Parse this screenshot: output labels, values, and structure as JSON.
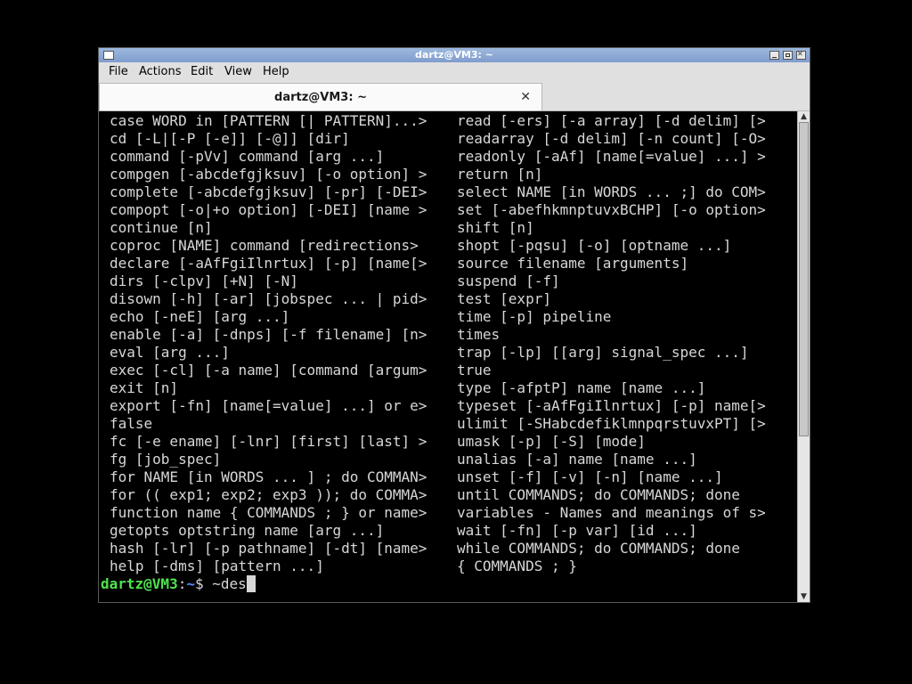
{
  "window": {
    "title": "dartz@VM3: ~"
  },
  "menu": [
    "File",
    "Actions",
    "Edit",
    "View",
    "Help"
  ],
  "tab": {
    "title": "dartz@VM3: ~",
    "close_icon": "✕"
  },
  "terminal": {
    "rows": [
      {
        "left": "case WORD in [PATTERN [| PATTERN]...>",
        "right": "read [-ers] [-a array] [-d delim] [>"
      },
      {
        "left": "cd [-L|[-P [-e]] [-@]] [dir]",
        "right": "readarray [-d delim] [-n count] [-O>"
      },
      {
        "left": "command [-pVv] command [arg ...]",
        "right": "readonly [-aAf] [name[=value] ...] >"
      },
      {
        "left": "compgen [-abcdefgjksuv] [-o option] >",
        "right": "return [n]"
      },
      {
        "left": "complete [-abcdefgjksuv] [-pr] [-DEI>",
        "right": "select NAME [in WORDS ... ;] do COM>"
      },
      {
        "left": "compopt [-o|+o option] [-DEI] [name >",
        "right": "set [-abefhkmnptuvxBCHP] [-o option>"
      },
      {
        "left": "continue [n]",
        "right": "shift [n]"
      },
      {
        "left": "coproc [NAME] command [redirections>",
        "right": "shopt [-pqsu] [-o] [optname ...]"
      },
      {
        "left": "declare [-aAfFgiIlnrtux] [-p] [name[>",
        "right": "source filename [arguments]"
      },
      {
        "left": "dirs [-clpv] [+N] [-N]",
        "right": "suspend [-f]"
      },
      {
        "left": "disown [-h] [-ar] [jobspec ... | pid>",
        "right": "test [expr]"
      },
      {
        "left": "echo [-neE] [arg ...]",
        "right": "time [-p] pipeline"
      },
      {
        "left": "enable [-a] [-dnps] [-f filename] [n>",
        "right": "times"
      },
      {
        "left": "eval [arg ...]",
        "right": "trap [-lp] [[arg] signal_spec ...]"
      },
      {
        "left": "exec [-cl] [-a name] [command [argum>",
        "right": "true"
      },
      {
        "left": "exit [n]",
        "right": "type [-afptP] name [name ...]"
      },
      {
        "left": "export [-fn] [name[=value] ...] or e>",
        "right": "typeset [-aAfFgiIlnrtux] [-p] name[>"
      },
      {
        "left": "false",
        "right": "ulimit [-SHabcdefiklmnpqrstuvxPT] [>"
      },
      {
        "left": "fc [-e ename] [-lnr] [first] [last] >",
        "right": "umask [-p] [-S] [mode]"
      },
      {
        "left": "fg [job_spec]",
        "right": "unalias [-a] name [name ...]"
      },
      {
        "left": "for NAME [in WORDS ... ] ; do COMMAN>",
        "right": "unset [-f] [-v] [-n] [name ...]"
      },
      {
        "left": "for (( exp1; exp2; exp3 )); do COMMA>",
        "right": "until COMMANDS; do COMMANDS; done"
      },
      {
        "left": "function name { COMMANDS ; } or name>",
        "right": "variables - Names and meanings of s>"
      },
      {
        "left": "getopts optstring name [arg ...]",
        "right": "wait [-fn] [-p var] [id ...]"
      },
      {
        "left": "hash [-lr] [-p pathname] [-dt] [name>",
        "right": "while COMMANDS; do COMMANDS; done"
      },
      {
        "left": "help [-dms] [pattern ...]",
        "right": "{ COMMANDS ; }"
      }
    ],
    "prompt": {
      "user_host": "dartz@VM3",
      "separator": ":",
      "path": "~",
      "symbol": "$ ",
      "input": "~des"
    }
  },
  "scrollbar": {
    "up_icon": "▲",
    "down_icon": "▼",
    "position": 0.0,
    "visible_fraction": 0.67
  },
  "colors": {
    "background": "#000000",
    "text": "#d7d7d7",
    "prompt_user": "#4ee44e",
    "prompt_path": "#5c8cff"
  }
}
